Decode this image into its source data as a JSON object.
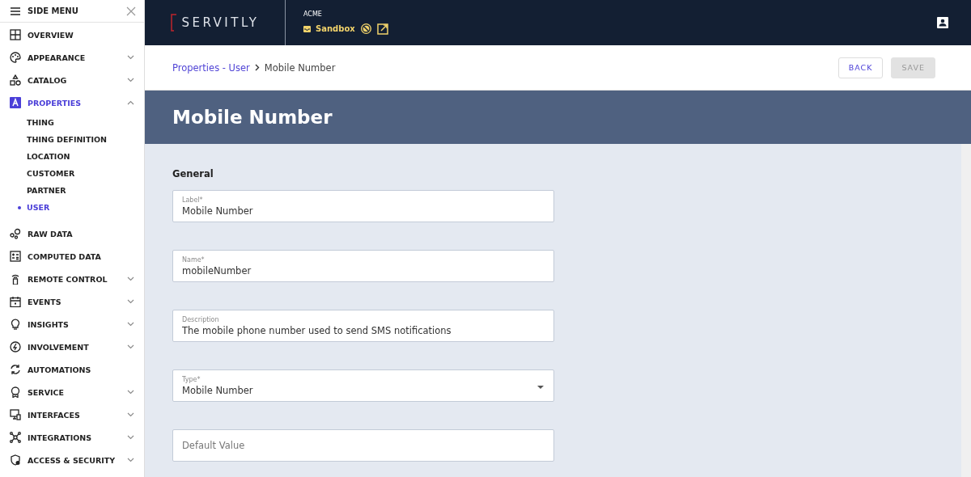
{
  "sidebar": {
    "title": "SIDE MENU",
    "items": [
      {
        "label": "OVERVIEW",
        "expandable": false,
        "selected": false
      },
      {
        "label": "APPEARANCE",
        "expandable": true,
        "expanded": false,
        "selected": false
      },
      {
        "label": "CATALOG",
        "expandable": true,
        "expanded": false,
        "selected": false
      },
      {
        "label": "PROPERTIES",
        "expandable": true,
        "expanded": true,
        "selected": true,
        "children": [
          {
            "label": "THING",
            "selected": false
          },
          {
            "label": "THING DEFINITION",
            "selected": false
          },
          {
            "label": "LOCATION",
            "selected": false
          },
          {
            "label": "CUSTOMER",
            "selected": false
          },
          {
            "label": "PARTNER",
            "selected": false
          },
          {
            "label": "USER",
            "selected": true
          }
        ]
      },
      {
        "label": "RAW DATA",
        "expandable": false,
        "selected": false
      },
      {
        "label": "COMPUTED DATA",
        "expandable": false,
        "selected": false
      },
      {
        "label": "REMOTE CONTROL",
        "expandable": true,
        "expanded": false,
        "selected": false
      },
      {
        "label": "EVENTS",
        "expandable": true,
        "expanded": false,
        "selected": false
      },
      {
        "label": "INSIGHTS",
        "expandable": true,
        "expanded": false,
        "selected": false
      },
      {
        "label": "INVOLVEMENT",
        "expandable": true,
        "expanded": false,
        "selected": false
      },
      {
        "label": "AUTOMATIONS",
        "expandable": false,
        "selected": false
      },
      {
        "label": "SERVICE",
        "expandable": true,
        "expanded": false,
        "selected": false
      },
      {
        "label": "INTERFACES",
        "expandable": true,
        "expanded": false,
        "selected": false
      },
      {
        "label": "INTEGRATIONS",
        "expandable": true,
        "expanded": false,
        "selected": false
      },
      {
        "label": "ACCESS & SECURITY",
        "expandable": true,
        "expanded": false,
        "selected": false
      }
    ]
  },
  "header": {
    "logo": "SERVITLY",
    "tenant": "ACME",
    "environment": "Sandbox"
  },
  "breadcrumb": {
    "link": "Properties - User",
    "current": "Mobile Number"
  },
  "buttons": [
    {
      "label": "BACK",
      "disabled": false
    },
    {
      "label": "SAVE",
      "disabled": true
    }
  ],
  "page_title": "Mobile Number",
  "section": "General",
  "fields": [
    {
      "kind": "text",
      "label": "Label*",
      "value": "Mobile Number"
    },
    {
      "kind": "text",
      "label": "Name*",
      "value": "mobileNumber"
    },
    {
      "kind": "text",
      "label": "Description",
      "value": "The mobile phone number used to send SMS notifications"
    },
    {
      "kind": "select",
      "label": "Type*",
      "value": "Mobile Number"
    },
    {
      "kind": "text",
      "placeholder": "Default Value"
    }
  ]
}
